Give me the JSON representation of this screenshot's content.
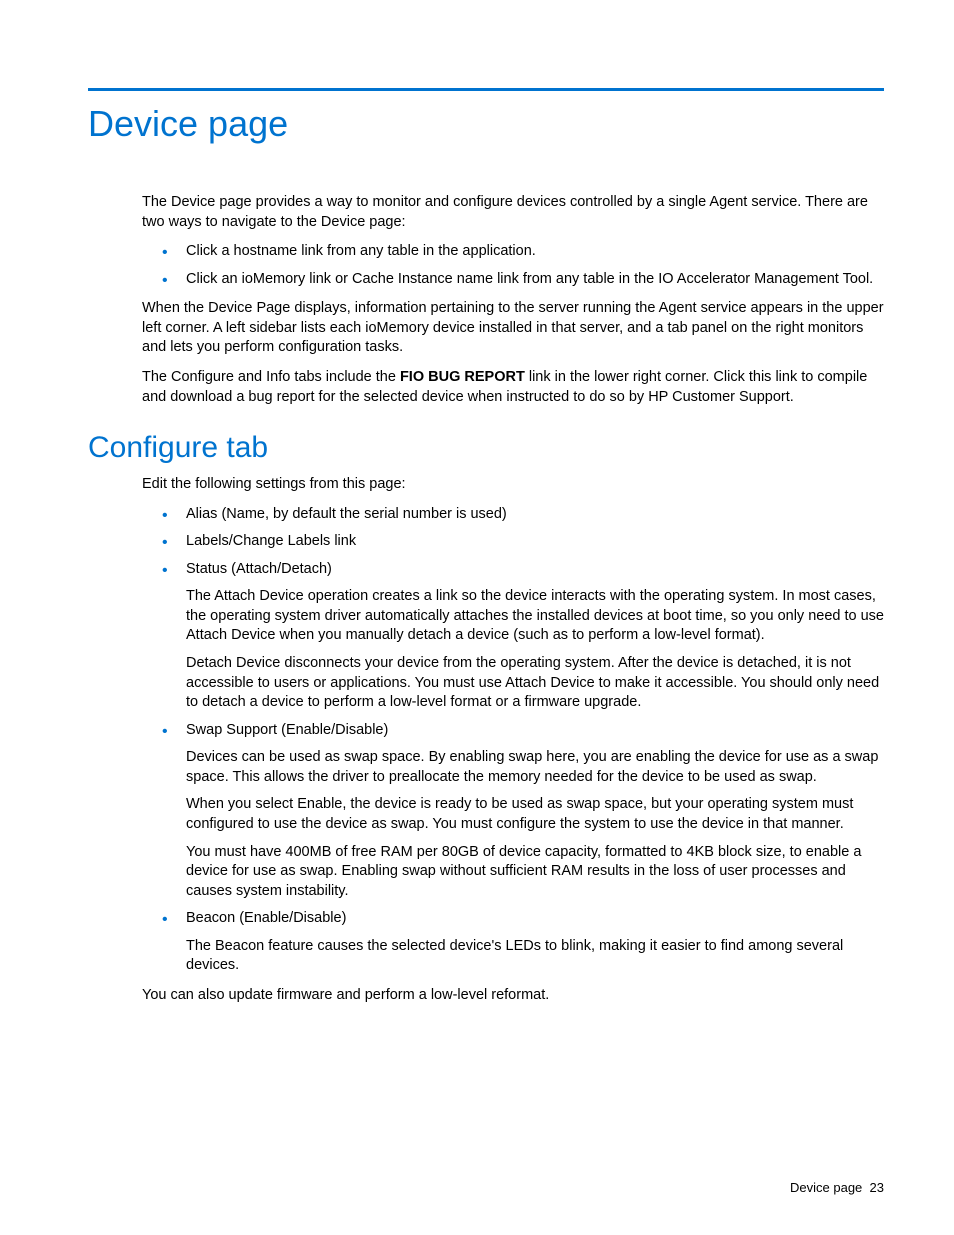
{
  "title": "Device page",
  "intro_p1": "The Device page provides a way to monitor and configure devices controlled by a single Agent service. There are two ways to navigate to the Device page:",
  "intro_bullets": [
    "Click a hostname link from any table in the application.",
    "Click an ioMemory link or Cache Instance name link from any table in the IO Accelerator Management Tool."
  ],
  "intro_p2": "When the Device Page displays, information pertaining to the server running the Agent service appears in the upper left corner. A left sidebar lists each ioMemory device installed in that server, and a tab panel on the right monitors and lets you perform configuration tasks.",
  "intro_p3_pre": "The Configure and Info tabs include the ",
  "intro_p3_bold": "FIO BUG REPORT",
  "intro_p3_post": " link in the lower right corner. Click this link to compile and download a bug report for the selected device when instructed to do so by HP Customer Support.",
  "section2_title": "Configure tab",
  "section2_intro": "Edit the following settings from this page:",
  "config_items": {
    "alias": "Alias (Name, by default the serial number is used)",
    "labels": "Labels/Change Labels link",
    "status_head": "Status (Attach/Detach)",
    "status_p1": "The Attach Device operation creates a link so the device interacts with the operating system. In most cases, the operating system driver automatically attaches the installed devices at boot time, so you only need to use Attach Device when you manually detach a device (such as to perform a low-level format).",
    "status_p2": "Detach Device disconnects your device from the operating system. After the device is detached, it is not accessible to users or applications. You must use Attach Device to make it accessible. You should only need to detach a device to perform a low-level format or a firmware upgrade.",
    "swap_head": "Swap Support (Enable/Disable)",
    "swap_p1": "Devices can be used as swap space. By enabling swap here, you are enabling the device for use as a swap space. This allows the driver to preallocate the memory needed for the device to be used as swap.",
    "swap_p2": "When you select Enable, the device is ready to be used as swap space, but your operating system must configured to use the device as swap. You must configure the system to use the device in that manner.",
    "swap_p3": "You must have 400MB of free RAM per 80GB of device capacity, formatted to 4KB block size, to enable a device for use as swap. Enabling swap without sufficient RAM results in the loss of user processes and causes system instability.",
    "beacon_head": "Beacon (Enable/Disable)",
    "beacon_p1": "The Beacon feature causes the selected device's LEDs to blink, making it easier to find among several devices."
  },
  "section2_outro": "You can also update firmware and perform a low-level reformat.",
  "footer_label": "Device page",
  "footer_page": "23"
}
